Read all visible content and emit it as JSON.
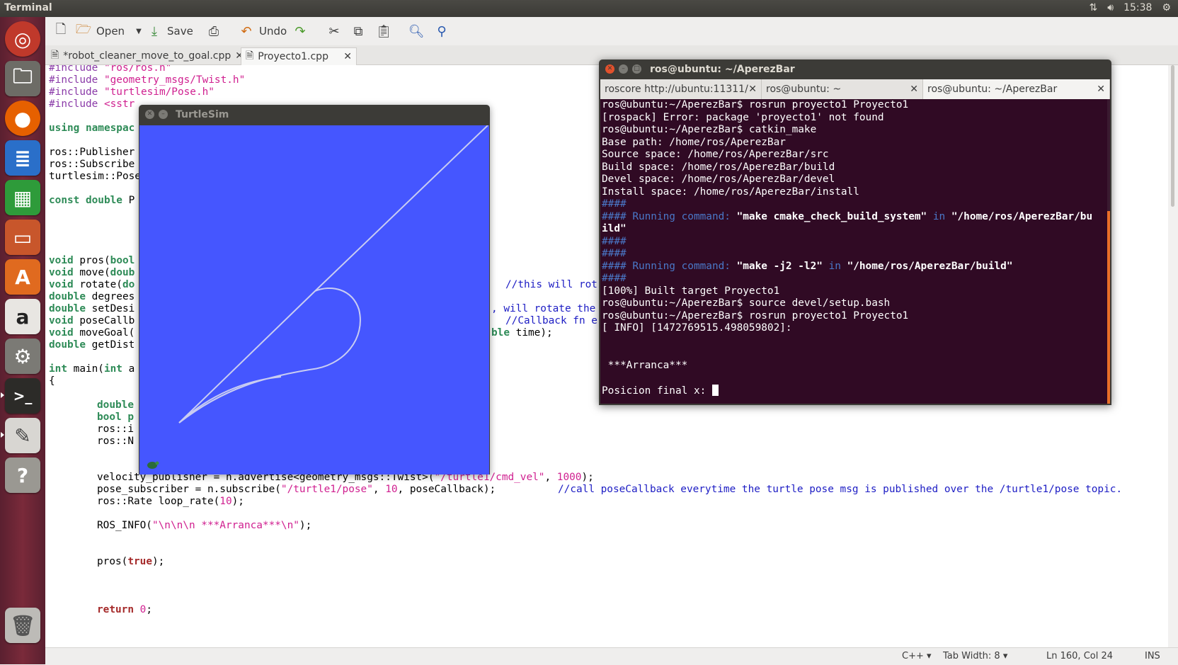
{
  "top_panel": {
    "title": "Terminal",
    "time": "15:38"
  },
  "toolbar": {
    "open_label": "Open",
    "save_label": "Save",
    "undo_label": "Undo"
  },
  "editor_tabs": [
    {
      "label": "*robot_cleaner_move_to_goal.cpp"
    },
    {
      "label": "Proyecto1.cpp"
    }
  ],
  "code": {
    "l1": {
      "a": "#include ",
      "b": "\"ros/ros.h\""
    },
    "l2": {
      "a": "#include ",
      "b": "\"geometry_msgs/Twist.h\""
    },
    "l3": {
      "a": "#include ",
      "b": "\"turtlesim/Pose.h\""
    },
    "l4": {
      "a": "#include ",
      "b": "<sstr"
    },
    "l6": {
      "a": "using ",
      "b": "namespac"
    },
    "l8": "ros::Publisher",
    "l9": "ros::Subscribe",
    "l10": "turtlesim::Pose",
    "l12": {
      "a": "const double ",
      "b": "P"
    },
    "l17": {
      "a": "void ",
      "b": "pros(",
      "c": "bool"
    },
    "l18": {
      "a": "void ",
      "b": "move(",
      "c": "doub"
    },
    "l19": {
      "a": "void ",
      "b": "rotate(",
      "c": "do",
      "d": "//this will rot"
    },
    "l20": {
      "a": "double ",
      "b": "degrees"
    },
    "l21": {
      "a": "double ",
      "b": "setDesi",
      "d": ", will rotate the"
    },
    "l22": {
      "a": "void ",
      "b": "poseCallb",
      "d": "//Callback fn e"
    },
    "l23": {
      "a": "void ",
      "b": "moveGoal(",
      "c": "ble",
      "d": " time);"
    },
    "l24": {
      "a": "double ",
      "b": "getDist"
    },
    "l26": {
      "a": "int ",
      "b": "main(",
      "c": "int ",
      "d": "a"
    },
    "l27": "{",
    "l29": "double",
    "l30": "bool p",
    "l31": "ros::i",
    "l32": "ros::N",
    "l35": {
      "a": "velocity_publisher = n.advertise<geometry_msgs::Twist>(",
      "b": "\"/turtle1/cmd_vel\"",
      "c": ", ",
      "d": "1000",
      "e": ");"
    },
    "l36": {
      "a": "pose_subscriber = n.subscribe(",
      "b": "\"/turtle1/pose\"",
      "c": ", ",
      "d": "10",
      "e": ", poseCallback);",
      "f": "//call poseCallback everytime the turtle pose msg is published over the /turtle1/pose topic."
    },
    "l37": {
      "a": "ros::Rate loop_rate(",
      "b": "10",
      "c": ");"
    },
    "l39": {
      "a": "ROS_INFO(",
      "b": "\"\\n\\n\\n ***Arranca***\\n\"",
      "c": ");"
    },
    "l42": {
      "a": "pros(",
      "b": "true",
      "c": ");"
    },
    "l46": {
      "a": "return ",
      "b": "0",
      "c": ";"
    }
  },
  "statusbar": {
    "language": "C++",
    "tab_width": "Tab Width: 8",
    "position": "Ln 160, Col 24",
    "mode": "INS"
  },
  "turtlesim": {
    "title": "TurtleSim",
    "background": "#4556ff"
  },
  "terminal": {
    "title": "ros@ubuntu: ~/AperezBar",
    "tabs": [
      {
        "label": "roscore http://ubuntu:11311/"
      },
      {
        "label": "ros@ubuntu: ~"
      },
      {
        "label": "ros@ubuntu: ~/AperezBar"
      }
    ],
    "lines": {
      "t1": "ros@ubuntu:~/AperezBar$ rosrun proyecto1 Proyecto1",
      "t2": "[rospack] Error: package 'proyecto1' not found",
      "t3": "ros@ubuntu:~/AperezBar$ catkin_make",
      "t4": "Base path: /home/ros/AperezBar",
      "t5": "Source space: /home/ros/AperezBar/src",
      "t6": "Build space: /home/ros/AperezBar/build",
      "t7": "Devel space: /home/ros/AperezBar/devel",
      "t8": "Install space: /home/ros/AperezBar/install",
      "t9": "####",
      "t10a": "#### Running command: ",
      "t10b": "\"make cmake_check_build_system\"",
      "t10c": " in ",
      "t10d": "\"/home/ros/AperezBar/bu",
      "t11": "ild\"",
      "t12": "####",
      "t13": "####",
      "t14a": "#### Running command: ",
      "t14b": "\"make -j2 -l2\"",
      "t14c": " in ",
      "t14d": "\"/home/ros/AperezBar/build\"",
      "t15": "####",
      "t16": "[100%] Built target Proyecto1",
      "t17": "ros@ubuntu:~/AperezBar$ source devel/setup.bash",
      "t18": "ros@ubuntu:~/AperezBar$ rosrun proyecto1 Proyecto1",
      "t19": "[ INFO] [1472769515.498059802]:",
      "t22": " ***Arranca***",
      "t24": "Posicion final x: "
    }
  },
  "launcher": [
    "ubuntu-logo-icon",
    "files-icon",
    "firefox-icon",
    "writer-icon",
    "calc-icon",
    "impress-icon",
    "software-center-icon",
    "amazon-icon",
    "system-settings-icon",
    "terminal-icon",
    "text-editor-icon",
    "help-icon",
    "trash-icon"
  ]
}
